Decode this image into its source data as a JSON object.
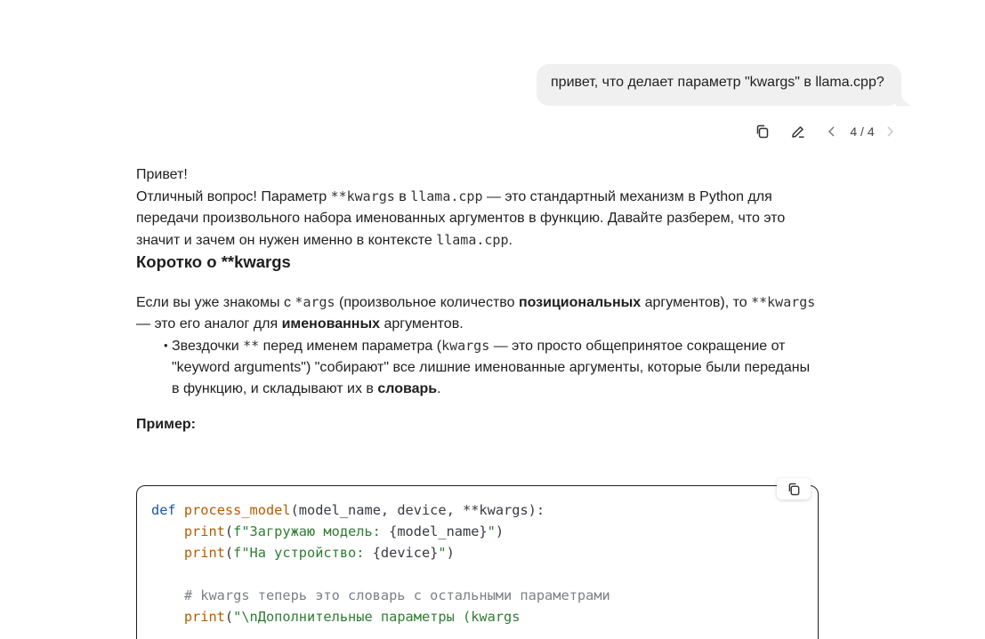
{
  "user_message": {
    "text": "привет, что делает параметр \"kwargs\" в llama.cpp?"
  },
  "message_actions": {
    "pager": "4 / 4",
    "icons": [
      "copy-icon",
      "edit-icon",
      "chevron-left-icon",
      "chevron-right-icon"
    ]
  },
  "answer": {
    "greeting": "Привет!",
    "intro": {
      "t1": "Отличный вопрос! Параметр ",
      "c1": "**kwargs",
      "t2": " в ",
      "c2": "llama.cpp",
      "t3": " — это стандартный механизм в Python для передачи произвольного набора именованных аргументов в функцию. Давайте разберем, что это значит и зачем он нужен именно в контексте ",
      "c3": "llama.cpp",
      "t4": "."
    },
    "heading": "Коротко о **kwargs",
    "args_par": {
      "t1": "Если вы уже знакомы с ",
      "c1": "*args",
      "t2": " (произвольное количество ",
      "b1": "позициональных",
      "t3": " аргументов), то ",
      "c2": "**kwargs",
      "t4": " — это его аналог для ",
      "b2": "именованных",
      "t5": " аргументов."
    },
    "bullet": {
      "t1": "Звездочки ",
      "c1": "**",
      "t2": " перед именем параметра (",
      "c2": "kwargs",
      "t3": " — это просто общепринятое сокращение от \"keyword arguments\") \"собирают\" все лишние именованные аргументы, которые были переданы в функцию, и складывают их в ",
      "b1": "словарь",
      "t4": "."
    },
    "example_label": "Пример:"
  },
  "code": {
    "l1_kw": "def",
    "l1_fn": "process_model",
    "l1_rest": "(model_name, device, **kwargs):",
    "l2_indent": "    ",
    "l2_bi": "print",
    "l2_p": "(",
    "l2_str": "f\"Загружаю модель: ",
    "l2_var": "{model_name}",
    "l2_str2": "\"",
    "l2_end": ")",
    "l3_indent": "    ",
    "l3_bi": "print",
    "l3_p": "(",
    "l3_str": "f\"На устройство: ",
    "l3_var": "{device}",
    "l3_str2": "\"",
    "l3_end": ")",
    "l5_indent": "    ",
    "l5_cm": "# kwargs теперь это словарь с остальными параметрами",
    "l6_indent": "    ",
    "l6_bi": "print",
    "l6_p": "(",
    "l6_str": "\"\\nДополнительные параметры (kwargs"
  }
}
